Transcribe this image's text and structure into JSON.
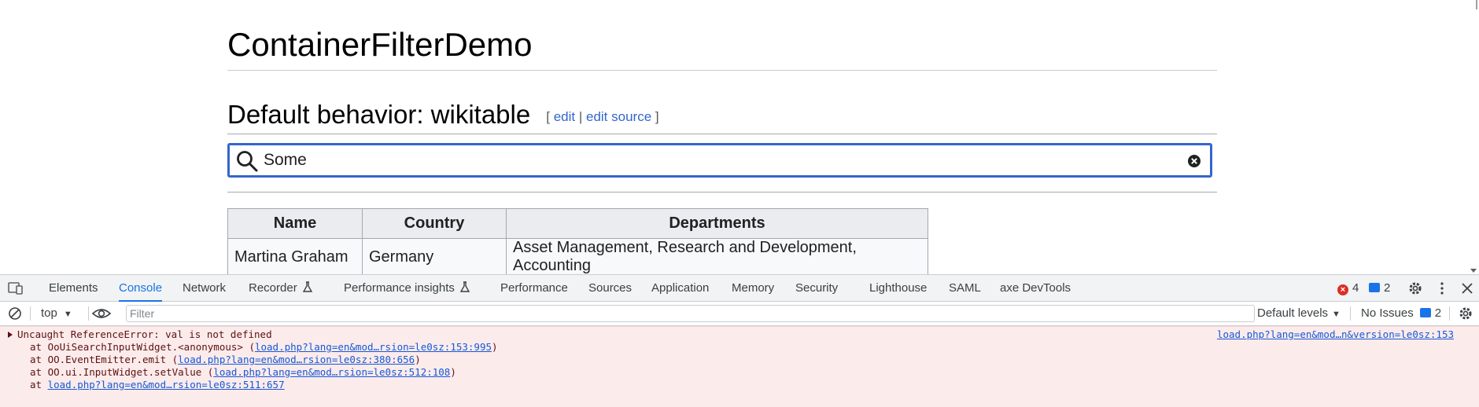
{
  "page": {
    "title": "ContainerFilterDemo",
    "section": {
      "heading": "Default behavior: wikitable",
      "edit_open": "[",
      "edit_label": "edit",
      "edit_sep": "|",
      "edit_source_label": "edit source",
      "edit_close": "]"
    },
    "search": {
      "value": "Some",
      "icon": "search-icon",
      "clear_icon": "clear-icon"
    },
    "table": {
      "headers": [
        "Name",
        "Country",
        "Departments"
      ],
      "rows": [
        [
          "Martina Graham",
          "Germany",
          "Asset Management, Research and Development, Accounting"
        ]
      ]
    }
  },
  "devtools": {
    "tabs": [
      "Elements",
      "Console",
      "Network",
      "Recorder",
      "Performance insights",
      "Performance",
      "Sources",
      "Application",
      "Memory",
      "Security",
      "Lighthouse",
      "SAML",
      "axe DevTools"
    ],
    "active_tab": "Console",
    "error_count": "4",
    "message_count": "2",
    "toolbar": {
      "context": "top",
      "filter_placeholder": "Filter",
      "levels": "Default levels",
      "issues_label": "No Issues",
      "issues_count": "2"
    },
    "error": {
      "message": "Uncaught ReferenceError: val is not defined",
      "source": "load.php?lang=en&mod…n&version=le0sz:153",
      "stack": [
        {
          "prefix": "at OoUiSearchInputWidget.<anonymous> (",
          "link": "load.php?lang=en&mod…rsion=le0sz:153:995",
          "suffix": ")"
        },
        {
          "prefix": "at OO.EventEmitter.emit (",
          "link": "load.php?lang=en&mod…rsion=le0sz:380:656",
          "suffix": ")"
        },
        {
          "prefix": "at OO.ui.InputWidget.setValue (",
          "link": "load.php?lang=en&mod…rsion=le0sz:512:108",
          "suffix": ")"
        },
        {
          "prefix": "at ",
          "link": "load.php?lang=en&mod…rsion=le0sz:511:657",
          "suffix": ""
        }
      ]
    },
    "colors": {
      "accent": "#1a73e8",
      "error_bg": "#fcebeb",
      "error_badge": "#d93025"
    }
  }
}
